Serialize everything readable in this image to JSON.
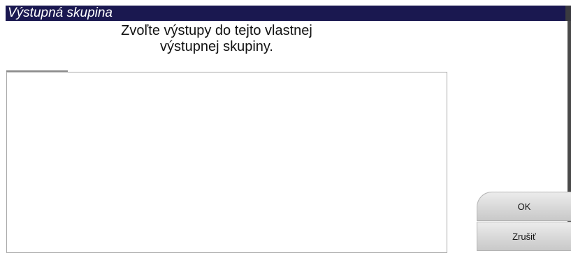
{
  "window": {
    "title": "Výstupná skupina"
  },
  "dialog": {
    "instruction_line1": "Zvoľte výstupy do tejto vlastnej",
    "instruction_line2": "výstupnej skupiny."
  },
  "outputs_list": {
    "items": []
  },
  "buttons": {
    "ok_label": "OK",
    "cancel_label": "Zrušiť"
  },
  "colors": {
    "title_bar": "#1a1850",
    "title_text": "#ffffff",
    "button_gradient_top": "#ececec",
    "button_gradient_bottom": "#c9c9c9"
  }
}
